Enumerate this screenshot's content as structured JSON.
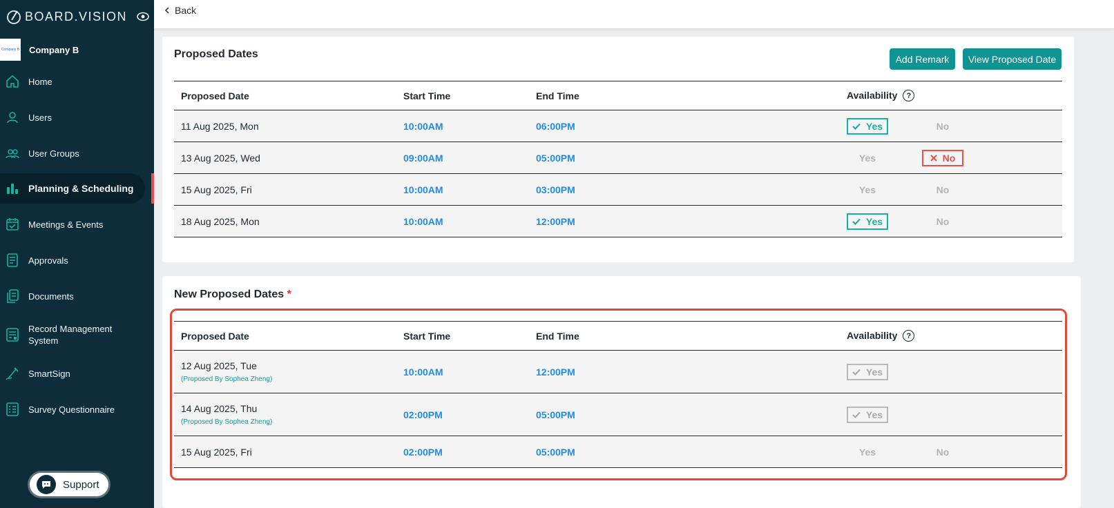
{
  "app": {
    "brand": "BOARD.VISION",
    "company_name": "Company B",
    "company_logo_text": "Company B"
  },
  "sidebar": {
    "items": [
      {
        "label": "Home",
        "icon": "home-icon"
      },
      {
        "label": "Users",
        "icon": "user-icon"
      },
      {
        "label": "User Groups",
        "icon": "user-groups-icon"
      },
      {
        "label": "Planning & Scheduling",
        "icon": "bar-chart-icon",
        "active": true
      },
      {
        "label": "Meetings & Events",
        "icon": "calendar-check-icon"
      },
      {
        "label": "Approvals",
        "icon": "approval-doc-icon"
      },
      {
        "label": "Documents",
        "icon": "documents-icon"
      },
      {
        "label": "Record Management System",
        "icon": "record-icon"
      },
      {
        "label": "SmartSign",
        "icon": "pen-icon"
      },
      {
        "label": "Survey Questionnaire",
        "icon": "survey-icon"
      }
    ],
    "support_label": "Support"
  },
  "topbar": {
    "back_label": "Back"
  },
  "proposed": {
    "title": "Proposed Dates",
    "add_remark_label": "Add Remark",
    "view_label": "View Proposed Date",
    "columns": [
      "Proposed Date",
      "Start Time",
      "End Time",
      "Availability"
    ],
    "rows": [
      {
        "date": "11 Aug 2025, Mon",
        "start": "10:00AM",
        "end": "06:00PM",
        "yes": "Yes",
        "no": "No",
        "selected": "yes"
      },
      {
        "date": "13 Aug 2025, Wed",
        "start": "09:00AM",
        "end": "05:00PM",
        "yes": "Yes",
        "no": "No",
        "selected": "no"
      },
      {
        "date": "15 Aug 2025, Fri",
        "start": "10:00AM",
        "end": "03:00PM",
        "yes": "Yes",
        "no": "No",
        "selected": "none"
      },
      {
        "date": "18 Aug 2025, Mon",
        "start": "10:00AM",
        "end": "12:00PM",
        "yes": "Yes",
        "no": "No",
        "selected": "yes"
      }
    ]
  },
  "new_proposed": {
    "title": "New Proposed Dates",
    "required_mark": "*",
    "columns": [
      "Proposed Date",
      "Start Time",
      "End Time",
      "Availability"
    ],
    "rows": [
      {
        "date": "12 Aug 2025, Tue",
        "note": "(Proposed By Sophea Zheng)",
        "start": "10:00AM",
        "end": "12:00PM",
        "yes": "Yes",
        "no": "",
        "selected": "yes-disabled"
      },
      {
        "date": "14 Aug 2025, Thu",
        "note": "(Proposed By Sophea Zheng)",
        "start": "02:00PM",
        "end": "05:00PM",
        "yes": "Yes",
        "no": "",
        "selected": "yes-disabled"
      },
      {
        "date": "15 Aug 2025, Fri",
        "note": "",
        "start": "02:00PM",
        "end": "05:00PM",
        "yes": "Yes",
        "no": "No",
        "selected": "none"
      }
    ]
  },
  "colors": {
    "sidebar_bg": "#0c2d39",
    "accent": "#0f9393",
    "time_blue": "#1f8de8",
    "yes_green": "#16b1a0",
    "no_red": "#e8504a",
    "highlight": "#e04a3b"
  },
  "help_glyph": "?"
}
